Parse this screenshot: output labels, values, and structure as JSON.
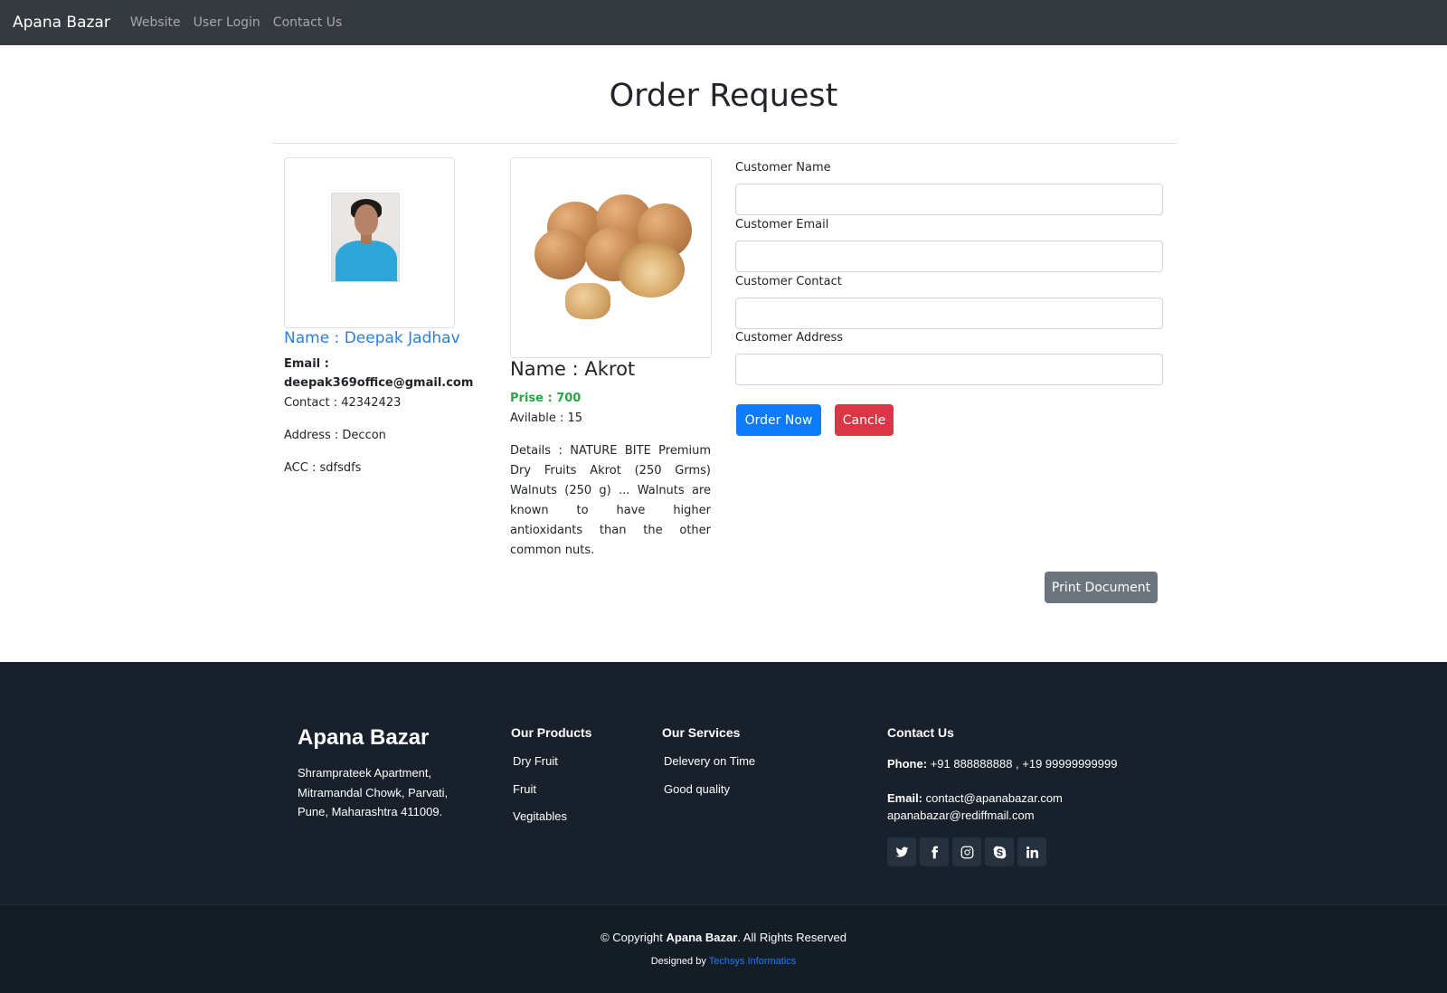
{
  "navbar": {
    "brand": "Apana Bazar",
    "links": [
      "Website",
      "User Login",
      "Contact Us"
    ]
  },
  "page": {
    "title": "Order Request"
  },
  "seller": {
    "name": "Name : Deepak Jadhav",
    "email_label": "Email :",
    "email": "deepak369office@gmail.com",
    "contact": "Contact : 42342423",
    "address": "Address : Deccon",
    "acc": "ACC : sdfsdfs"
  },
  "product": {
    "name": "Name : Akrot",
    "price": "Prise : 700",
    "available": "Avilable : 15",
    "details": "Details : NATURE BITE Premium Dry Fruits Akrot (250 Grms) Walnuts (250 g) ... Walnuts are known to have higher antioxidants than the other common nuts."
  },
  "form": {
    "customer_name_label": "Customer Name",
    "customer_name_value": "",
    "customer_email_label": "Customer Email",
    "customer_email_value": "",
    "customer_contact_label": "Customer Contact",
    "customer_contact_value": "",
    "customer_address_label": "Customer Address",
    "customer_address_value": "",
    "order_button": "Order Now",
    "cancel_button": "Cancle"
  },
  "print_button": "Print Document",
  "footer": {
    "brand": "Apana Bazar",
    "address": "Shramprateek Apartment, Mitramandal Chowk, Parvati, Pune, Maharashtra 411009.",
    "products_heading": "Our Products",
    "products": [
      "Dry Fruit",
      "Fruit",
      "Vegitables"
    ],
    "services_heading": "Our Services",
    "services": [
      "Delevery on Time",
      "Good quality"
    ],
    "contact_heading": "Contact Us",
    "phone_label": "Phone:",
    "phone": "+91 888888888 , +19 99999999999",
    "email_label": "Email:",
    "email1": "contact@apanabazar.com",
    "email2": "apanabazar@rediffmail.com",
    "social_icons": [
      "twitter-icon",
      "facebook-icon",
      "instagram-icon",
      "skype-icon",
      "linkedin-icon"
    ],
    "copyright_prefix": "© Copyright ",
    "copyright_brand": "Apana Bazar",
    "copyright_suffix": ". All Rights Reserved",
    "designed_prefix": "Designed by ",
    "designed_by": "Techsys Informatics"
  },
  "colors": {
    "navbar_bg": "#343a40",
    "link_blue": "#2b7fe0",
    "price_green": "#28a745",
    "primary": "#0d7bff",
    "danger": "#dc3545",
    "secondary": "#6c757d",
    "footer_bg": "#18212b"
  }
}
